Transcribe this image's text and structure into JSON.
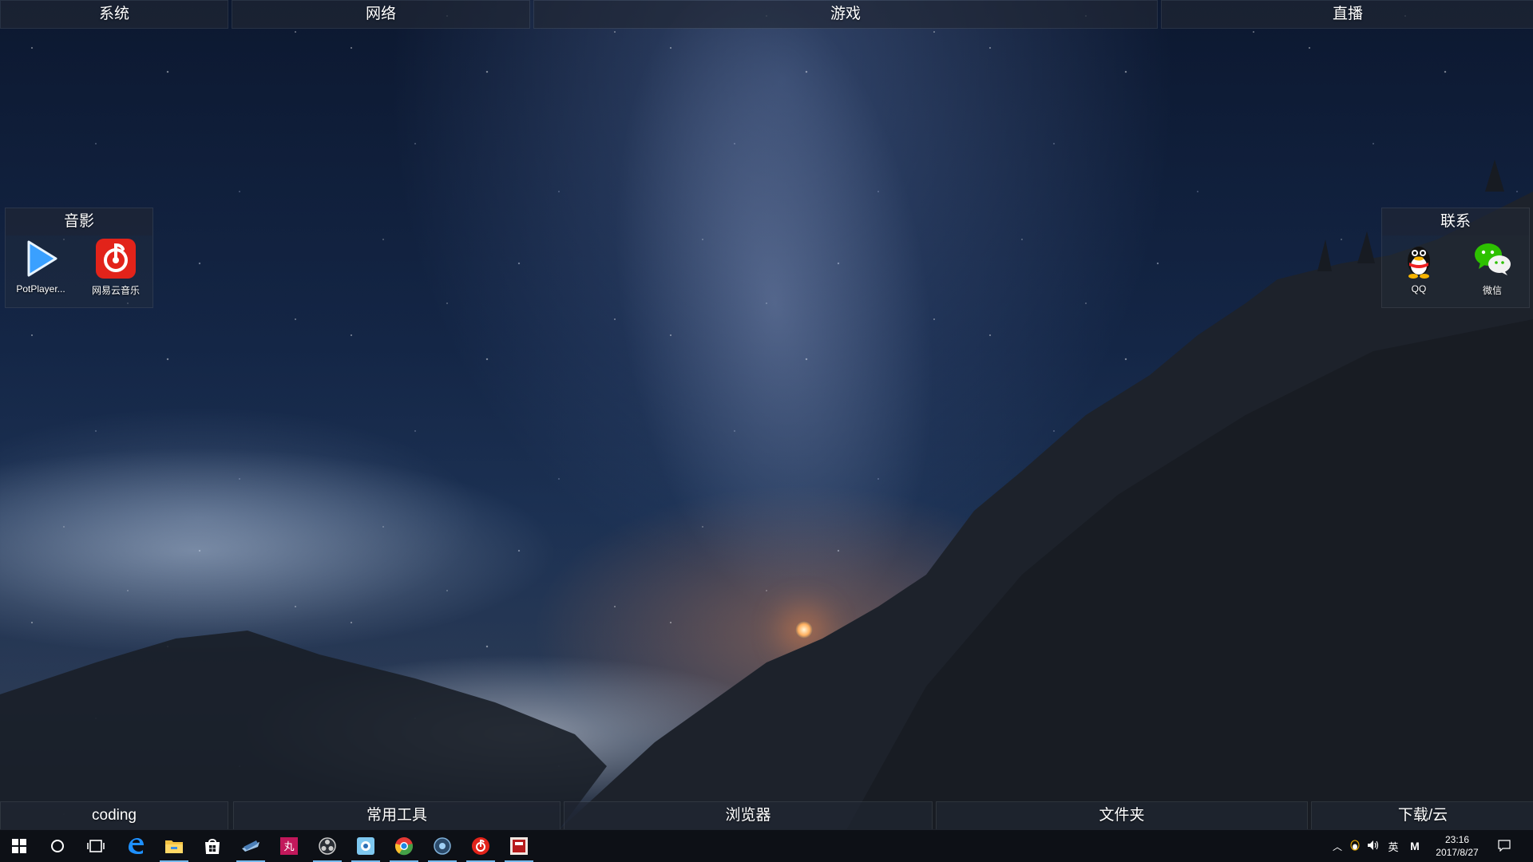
{
  "fences_top": [
    {
      "title": "系统"
    },
    {
      "title": "网络"
    },
    {
      "title": "游戏"
    },
    {
      "title": "直播"
    }
  ],
  "fence_media": {
    "title": "音影",
    "icons": [
      {
        "label": "PotPlayer...",
        "icon": "potplayer-icon"
      },
      {
        "label": "网易云音乐",
        "icon": "netease-music-icon"
      }
    ]
  },
  "fence_contact": {
    "title": "联系",
    "icons": [
      {
        "label": "QQ",
        "icon": "qq-icon"
      },
      {
        "label": "微信",
        "icon": "wechat-icon"
      }
    ]
  },
  "fences_bottom": [
    {
      "title": "coding"
    },
    {
      "title": "常用工具"
    },
    {
      "title": "浏览器"
    },
    {
      "title": "文件夹"
    },
    {
      "title": "下载/云"
    }
  ],
  "taskbar": {
    "apps": [
      {
        "icon": "edge-icon",
        "running": false
      },
      {
        "icon": "file-explorer-icon",
        "running": true
      },
      {
        "icon": "store-icon",
        "running": false
      },
      {
        "icon": "steam-icon",
        "running": true
      },
      {
        "icon": "app-pink-icon",
        "running": false
      },
      {
        "icon": "obs-icon",
        "running": true
      },
      {
        "icon": "app-blue-icon",
        "running": true
      },
      {
        "icon": "chrome-icon",
        "running": true
      },
      {
        "icon": "app-circle-icon",
        "running": true
      },
      {
        "icon": "netease-music-icon",
        "running": true
      },
      {
        "icon": "app-red-icon",
        "running": true
      }
    ],
    "tray": {
      "ime_lang": "英",
      "ime_mode": "M",
      "time": "23:16",
      "date": "2017/8/27"
    }
  },
  "colors": {
    "accent": "#76b9ed",
    "taskbar_bg": "#0d1016",
    "netease_red": "#e2231a",
    "wechat_green": "#2dc100"
  }
}
